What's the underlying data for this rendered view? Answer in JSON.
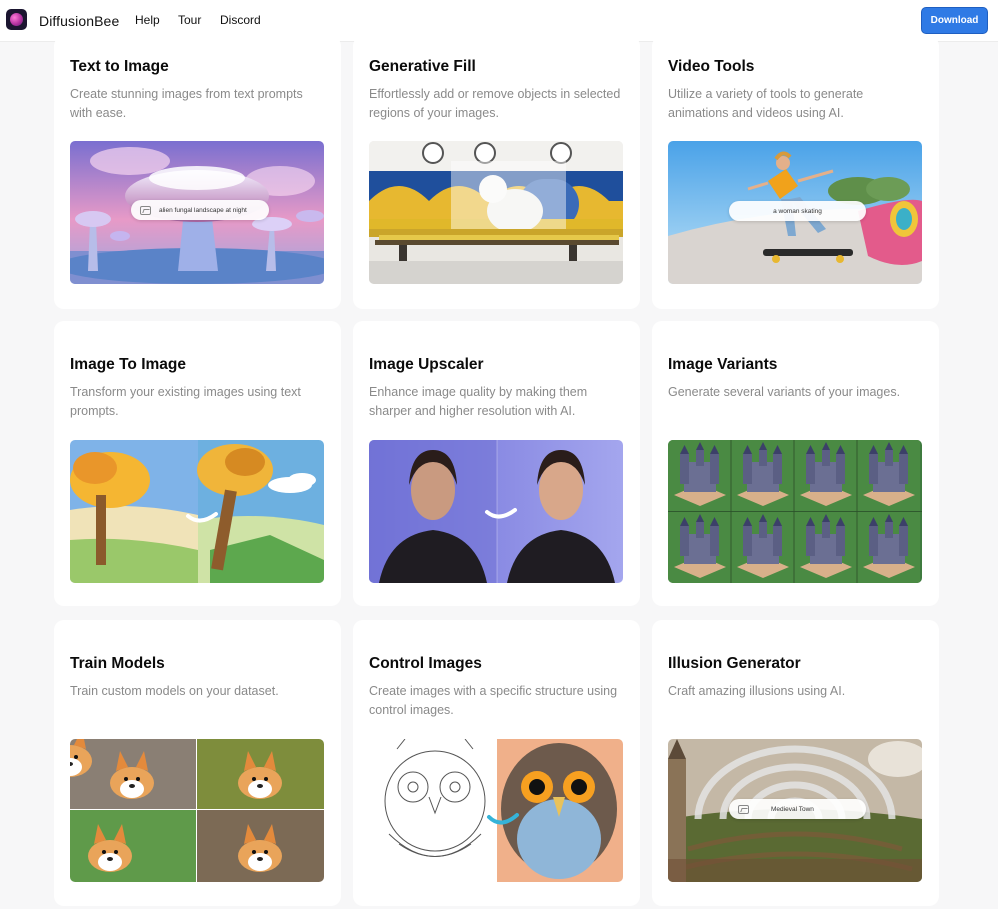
{
  "header": {
    "brand": "DiffusionBee",
    "nav": [
      "Help",
      "Tour",
      "Discord"
    ],
    "download_label": "Download"
  },
  "cards": [
    {
      "title": "Text to Image",
      "desc": "Create stunning images from text prompts with ease.",
      "prompt": "alien fungal landscape at night"
    },
    {
      "title": "Generative Fill",
      "desc": "Effortlessly add or remove objects in selected regions of your images."
    },
    {
      "title": "Video Tools",
      "desc": "Utilize a variety of tools to generate animations and videos using AI.",
      "prompt": "a woman skating"
    },
    {
      "title": "Image To Image",
      "desc": "Transform your existing images using text prompts."
    },
    {
      "title": "Image Upscaler",
      "desc": "Enhance image quality by making them sharper and higher resolution with AI."
    },
    {
      "title": "Image Variants",
      "desc": "Generate several variants of your images."
    },
    {
      "title": "Train Models",
      "desc": "Train custom models on your dataset."
    },
    {
      "title": "Control Images",
      "desc": "Create images with a specific structure using control images."
    },
    {
      "title": "Illusion Generator",
      "desc": "Craft amazing illusions using AI.",
      "prompt": "Medieval Town"
    }
  ],
  "colors": {
    "accent": "#2f7ae5",
    "page_bg": "#f7f7f8",
    "card_bg": "#ffffff",
    "desc_text": "#8a8a8a"
  },
  "icons": [
    "app-logo",
    "image-icon",
    "arrow-icon"
  ]
}
